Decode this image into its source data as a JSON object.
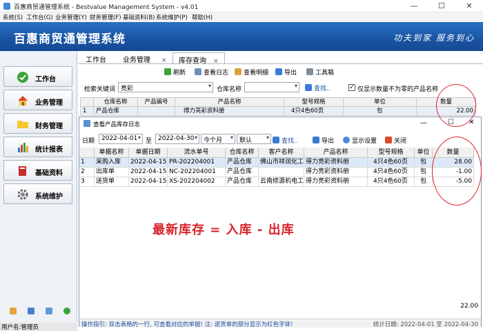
{
  "window": {
    "title": "百惠商贸通管理系统 - Bestvalue Management System - v4.01",
    "minimize": "—",
    "maximize": "☐",
    "close": "✕"
  },
  "menu": [
    "系统(S)",
    "工作台(G)",
    "业务管理(Y)",
    "财务管理(F)",
    "基础资料(B)",
    "系统维护(P)",
    "帮助(H)"
  ],
  "banner": {
    "title": "百惠商贸通管理系统",
    "slogan": "功夫到家 服务到心"
  },
  "sidebar": {
    "items": [
      {
        "label": "工作台",
        "icon": "check-circle-icon"
      },
      {
        "label": "业务管理",
        "icon": "house-icon"
      },
      {
        "label": "财务管理",
        "icon": "folder-icon"
      },
      {
        "label": "统计报表",
        "icon": "bar-chart-icon"
      },
      {
        "label": "基础资料",
        "icon": "book-icon"
      },
      {
        "label": "系统维护",
        "icon": "gear-icon"
      }
    ],
    "user": "用户名:管理员"
  },
  "tabs": [
    {
      "label": "工作台",
      "closable": false
    },
    {
      "label": "业务管理",
      "closable": true
    },
    {
      "label": "库存查询",
      "closable": true,
      "active": true
    }
  ],
  "tab_close_glyph": "×",
  "toolbar": {
    "refresh": "刷新",
    "view_log": "查看日志",
    "view_detail": "查看明细",
    "export": "导出",
    "toolbox": "工具箱"
  },
  "search": {
    "keyword_label": "检索关键词",
    "keyword_value": "亮彩",
    "warehouse_label": "仓库名称",
    "warehouse_value": "",
    "search_btn": "查找..",
    "nonzero_label": "仅显示数量不为零的产品名称",
    "nonzero_checked": "✓"
  },
  "main_grid": {
    "headers": [
      "仓库名称",
      "产品编号",
      "产品名称",
      "型号规格",
      "单位",
      "数量"
    ],
    "row": {
      "index": "1",
      "warehouse": "产品仓库",
      "code": "",
      "name": "得力亮彩资料册",
      "spec": "4只4色60页",
      "unit": "包",
      "qty": "22.00"
    }
  },
  "dialog": {
    "title": "查看产品库存日志",
    "date_label": "日期",
    "date_from": "2022-04-01",
    "to_label": "至",
    "date_to": "2022-04-30",
    "period": "今个月",
    "order": "默认",
    "search_btn": "查找..",
    "export_btn": "导出",
    "display_btn": "显示设置",
    "close_btn": "关闭",
    "headers": [
      "单据名称",
      "单据日期",
      "流水单号",
      "仓库名称",
      "客户名称",
      "产品名称",
      "型号规格",
      "单位",
      "数量"
    ],
    "rows": [
      {
        "index": "1",
        "doc": "采购入库",
        "date": "2022-04-15",
        "serial": "PR-202204001",
        "warehouse": "产品仓库",
        "customer": "佛山市祥润化工",
        "product": "得力亮彩资料册",
        "spec": "4只4色60页",
        "unit": "包",
        "qty": "28.00"
      },
      {
        "index": "2",
        "doc": "出库单",
        "date": "2022-04-15",
        "serial": "NC-202204001",
        "warehouse": "产品仓库",
        "customer": "",
        "product": "得力亮彩资料册",
        "spec": "4只4色60页",
        "unit": "包",
        "qty": "-1.00"
      },
      {
        "index": "3",
        "doc": "送货单",
        "date": "2022-04-15",
        "serial": "XS-202204002",
        "warehouse": "产品仓库",
        "customer": "云南修源机电工",
        "product": "得力亮彩资料册",
        "spec": "4只4色60页",
        "unit": "包",
        "qty": "-5.00"
      }
    ],
    "annotation": "最新库存 = 入库 - 出库",
    "total": "22.00",
    "status_hint": "操作指引: 双击表格的一行, 可查看对应的单据! 注: 退货单的部分显示为红色字体!",
    "status_period": "统计日期: 2022-04-01 至 2022-04-30"
  },
  "colors": {
    "banner": "#1a56a6",
    "annotation": "#d9232b",
    "selected_row": "#dce9f8"
  }
}
